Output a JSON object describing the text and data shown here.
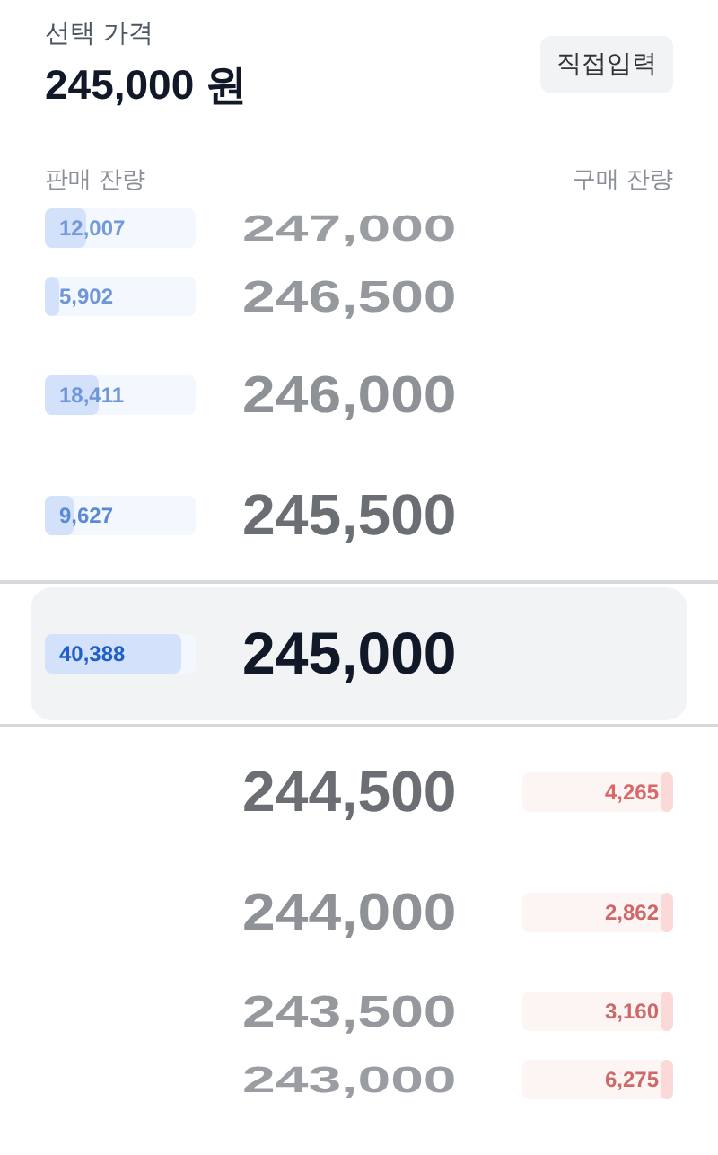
{
  "header": {
    "label": "선택 가격",
    "value": "245,000 원",
    "button": "직접입력"
  },
  "columns": {
    "sell": "판매 잔량",
    "buy": "구매 잔량"
  },
  "rows": [
    {
      "price": "247,000",
      "kind": "sell",
      "volume": "12,007",
      "level": 0.27,
      "selected": false
    },
    {
      "price": "246,500",
      "kind": "sell",
      "volume": "5,902",
      "level": 0.09,
      "selected": false
    },
    {
      "price": "246,000",
      "kind": "sell",
      "volume": "18,411",
      "level": 0.36,
      "selected": false
    },
    {
      "price": "245,500",
      "kind": "sell",
      "volume": "9,627",
      "level": 0.19,
      "selected": false
    },
    {
      "price": "245,000",
      "kind": "sell",
      "volume": "40,388",
      "level": 0.9,
      "selected": true
    },
    {
      "price": "244,500",
      "kind": "buy",
      "volume": "4,265",
      "level": 0.08,
      "selected": false
    },
    {
      "price": "244,000",
      "kind": "buy",
      "volume": "2,862",
      "level": 0.08,
      "selected": false
    },
    {
      "price": "243,500",
      "kind": "buy",
      "volume": "3,160",
      "level": 0.08,
      "selected": false
    },
    {
      "price": "243,000",
      "kind": "buy",
      "volume": "6,275",
      "level": 0.08,
      "selected": false
    }
  ]
}
